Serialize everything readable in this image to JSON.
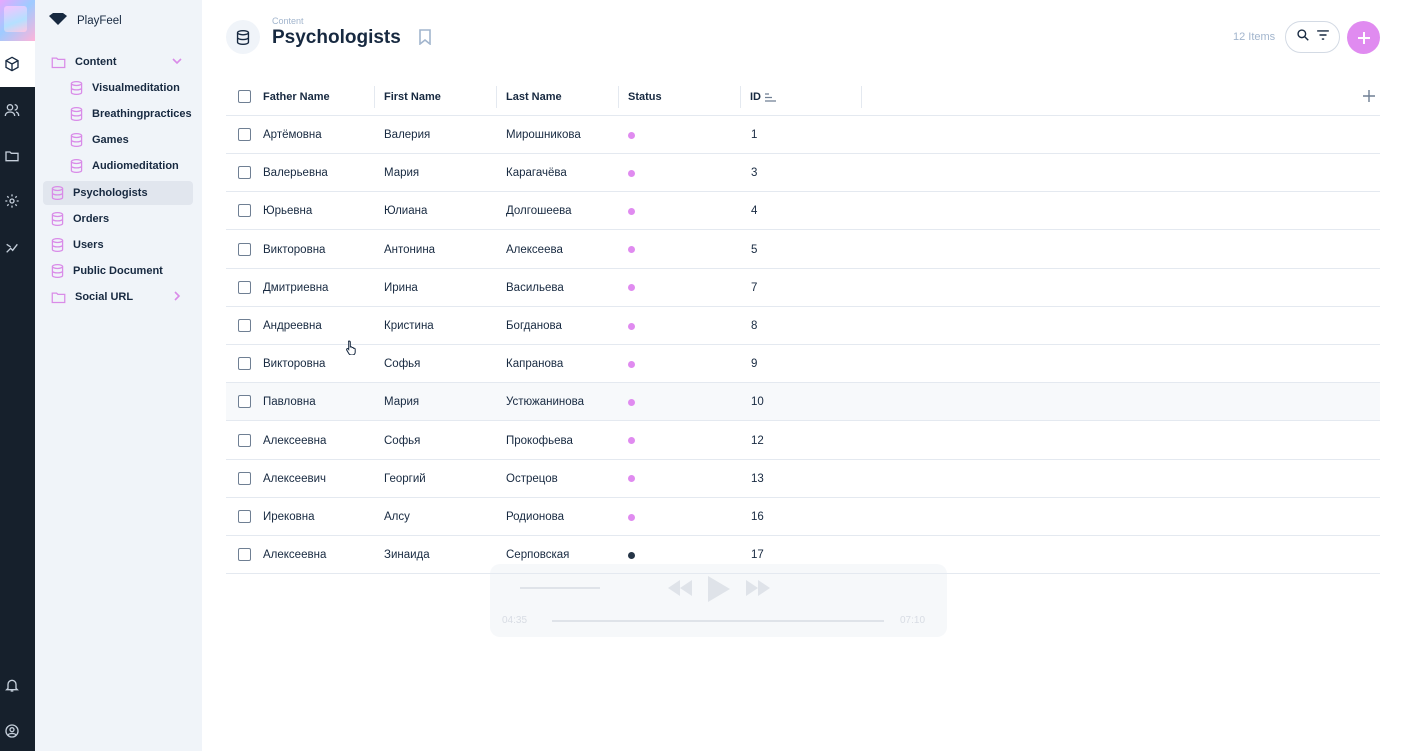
{
  "app": {
    "name": "PlayFeel"
  },
  "colors": {
    "accent": "#e08bf0",
    "rail_bg": "#16202c",
    "nav_bg": "#f0f4f9",
    "status_published": "#e08bf0",
    "status_draft": "#263547"
  },
  "rail": {
    "icons": [
      "content-cube-icon",
      "users-icon",
      "folder-icon",
      "settings-gear-icon",
      "insights-icon",
      "bell-icon",
      "account-circle-icon"
    ]
  },
  "nav": {
    "items": [
      {
        "label": "Content",
        "icon": "folder-icon",
        "expand": "chevron-down"
      },
      {
        "label": "Visualmeditation",
        "icon": "database-icon",
        "sub": true
      },
      {
        "label": "Breathingpractices",
        "icon": "database-icon",
        "sub": true
      },
      {
        "label": "Games",
        "icon": "database-icon",
        "sub": true
      },
      {
        "label": "Audiomeditation",
        "icon": "database-icon",
        "sub": true
      },
      {
        "label": "Psychologists",
        "icon": "database-icon",
        "active": true
      },
      {
        "label": "Orders",
        "icon": "database-icon"
      },
      {
        "label": "Users",
        "icon": "database-icon"
      },
      {
        "label": "Public Document",
        "icon": "database-icon"
      },
      {
        "label": "Social URL",
        "icon": "folder-icon",
        "expand": "chevron-right"
      }
    ]
  },
  "header": {
    "breadcrumb": "Content",
    "title": "Psychologists",
    "items_count": "12 Items"
  },
  "table": {
    "columns": [
      "Father Name",
      "First Name",
      "Last Name",
      "Status",
      "ID"
    ],
    "rows": [
      {
        "father": "Артёмовна",
        "first": "Валерия",
        "last": "Мирошникова",
        "status": "published",
        "id": "1"
      },
      {
        "father": "Валерьевна",
        "first": "Мария",
        "last": "Карагачёва",
        "status": "published",
        "id": "3"
      },
      {
        "father": "Юрьевна",
        "first": "Юлиана",
        "last": "Долгошеева",
        "status": "published",
        "id": "4"
      },
      {
        "father": "Викторовна",
        "first": "Антонина",
        "last": "Алексеева",
        "status": "published",
        "id": "5"
      },
      {
        "father": "Дмитриевна",
        "first": "Ирина",
        "last": "Васильева",
        "status": "published",
        "id": "7"
      },
      {
        "father": "Андреевна",
        "first": "Кристина",
        "last": "Богданова",
        "status": "published",
        "id": "8"
      },
      {
        "father": "Викторовна",
        "first": "Софья",
        "last": "Капранова",
        "status": "published",
        "id": "9"
      },
      {
        "father": "Павловна",
        "first": "Мария",
        "last": "Устюжанинова",
        "status": "published",
        "id": "10",
        "hover": true
      },
      {
        "father": "Алексеевна",
        "first": "Софья",
        "last": "Прокофьева",
        "status": "published",
        "id": "12"
      },
      {
        "father": "Алексеевич",
        "first": "Георгий",
        "last": "Острецов",
        "status": "published",
        "id": "13"
      },
      {
        "father": "Ирековна",
        "first": "Алсу",
        "last": "Родионова",
        "status": "published",
        "id": "16"
      },
      {
        "father": "Алексеевна",
        "first": "Зинаида",
        "last": "Серповская",
        "status": "draft",
        "id": "17"
      }
    ]
  },
  "media_overlay": {
    "elapsed": "04:35",
    "remaining": "07:10"
  }
}
